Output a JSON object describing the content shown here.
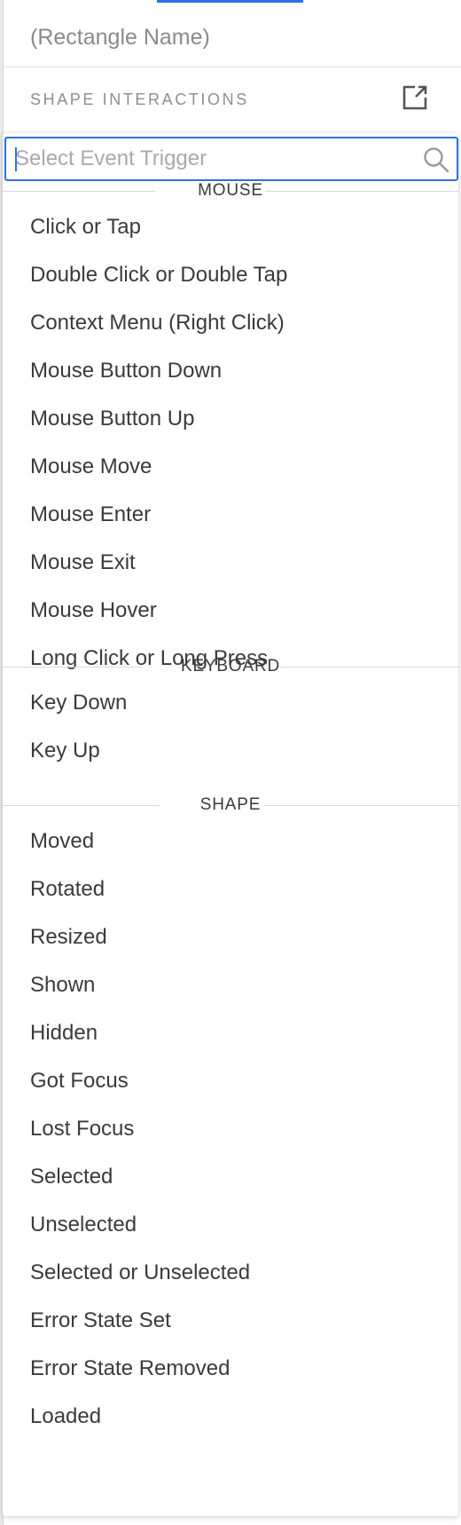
{
  "inspector": {
    "name_placeholder": "(Rectangle Name)",
    "section_title": "SHAPE INTERACTIONS",
    "popout_icon": "external-link-icon"
  },
  "search": {
    "placeholder": "Select Event Trigger",
    "value": "",
    "icon": "search-icon"
  },
  "colors": {
    "accent": "#2f6fe0",
    "text": "#3a3a3c",
    "muted": "#8e8e93"
  },
  "groups": [
    {
      "label": "MOUSE",
      "items": [
        "Click or Tap",
        "Double Click or Double Tap",
        "Context Menu (Right Click)",
        "Mouse Button Down",
        "Mouse Button Up",
        "Mouse Move",
        "Mouse Enter",
        "Mouse Exit",
        "Mouse Hover",
        "Long Click or Long Press"
      ]
    },
    {
      "label": "KEYBOARD",
      "items": [
        "Key Down",
        "Key Up"
      ]
    },
    {
      "label": "SHAPE",
      "items": [
        "Moved",
        "Rotated",
        "Resized",
        "Shown",
        "Hidden",
        "Got Focus",
        "Lost Focus",
        "Selected",
        "Unselected",
        "Selected or Unselected",
        "Error State Set",
        "Error State Removed",
        "Loaded"
      ]
    }
  ]
}
